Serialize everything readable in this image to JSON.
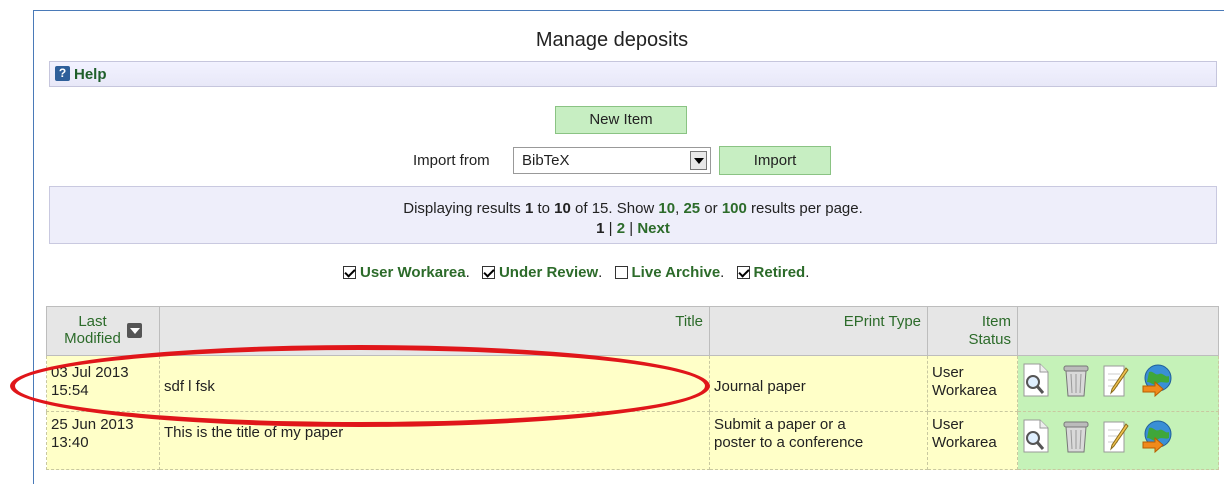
{
  "page": {
    "title": "Manage deposits"
  },
  "help": {
    "label": "Help",
    "icon": "help-icon"
  },
  "actions": {
    "new_item": "New Item",
    "import_label": "Import from",
    "import_format": "BibTeX",
    "import_button": "Import"
  },
  "results": {
    "t1": "Displaying results ",
    "from": "1",
    "t2": " to ",
    "to": "10",
    "t3": " of ",
    "total": "15",
    "t4": ". Show ",
    "opt1": "10",
    "t5": ", ",
    "opt2": "25",
    "t6": " or ",
    "opt3": "100",
    "t7": " results per page.",
    "page_current": "1",
    "sep1": " | ",
    "page_2": "2",
    "sep2": " | ",
    "next": "Next"
  },
  "filters": [
    {
      "label": "User Workarea",
      "checked": true
    },
    {
      "label": "Under Review",
      "checked": true
    },
    {
      "label": "Live Archive",
      "checked": false
    },
    {
      "label": "Retired",
      "checked": true
    }
  ],
  "table": {
    "headers": {
      "last_modified_1": "Last",
      "last_modified_2": "Modified",
      "title": "Title",
      "eprint_type": "EPrint Type",
      "item_status_1": "Item",
      "item_status_2": "Status"
    },
    "rows": [
      {
        "date": "03 Jul 2013",
        "time": "15:54",
        "title": "sdf l fsk",
        "type_1": "Journal paper",
        "type_2": "",
        "status_1": "User",
        "status_2": "Workarea"
      },
      {
        "date": "25 Jun 2013",
        "time": "13:40",
        "title": "This is the title of my paper",
        "type_1": "Submit a paper or a",
        "type_2": "poster to a conference",
        "status_1": "User",
        "status_2": "Workarea"
      }
    ],
    "row_action_icons": [
      "view-icon",
      "trash-icon",
      "edit-icon",
      "deposit-globe-icon"
    ]
  },
  "colors": {
    "accent_green": "#2c6b2a",
    "button_bg": "#c7eec2",
    "row_bg": "#ffffc8",
    "annotation": "#e0161a"
  }
}
